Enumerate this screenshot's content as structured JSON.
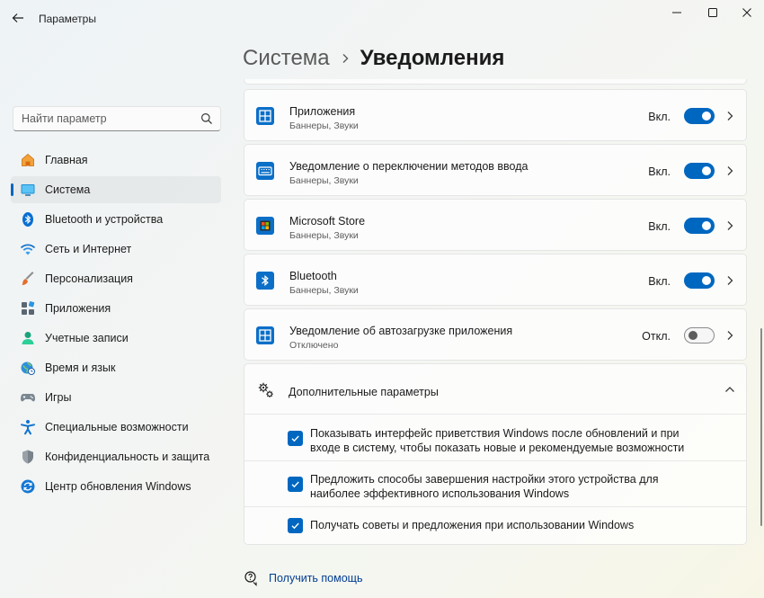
{
  "window": {
    "title": "Параметры",
    "back_icon": "arrow-left-icon",
    "controls": [
      "minimize-icon",
      "maximize-icon",
      "close-icon"
    ]
  },
  "breadcrumb": {
    "parent": "Система",
    "separator_icon": "chevron-right-icon",
    "current": "Уведомления"
  },
  "search": {
    "placeholder": "Найти параметр",
    "value": "",
    "icon": "search-icon"
  },
  "sidebar": {
    "active_index": 1,
    "items": [
      {
        "label": "Главная",
        "icon": "home-icon"
      },
      {
        "label": "Система",
        "icon": "system-display-icon"
      },
      {
        "label": "Bluetooth и устройства",
        "icon": "bluetooth-icon"
      },
      {
        "label": "Сеть и Интернет",
        "icon": "wifi-icon"
      },
      {
        "label": "Персонализация",
        "icon": "brush-icon"
      },
      {
        "label": "Приложения",
        "icon": "apps-icon"
      },
      {
        "label": "Учетные записи",
        "icon": "account-icon"
      },
      {
        "label": "Время и язык",
        "icon": "globe-clock-icon"
      },
      {
        "label": "Игры",
        "icon": "gamepad-icon"
      },
      {
        "label": "Специальные возможности",
        "icon": "accessibility-icon"
      },
      {
        "label": "Конфиденциальность и защита",
        "icon": "shield-icon"
      },
      {
        "label": "Центр обновления Windows",
        "icon": "update-icon"
      }
    ]
  },
  "notifications": {
    "apps": [
      {
        "title": "Приложения",
        "subtitle": "Баннеры, Звуки",
        "state": "Вкл.",
        "on": true,
        "icon": "apps-window-icon"
      },
      {
        "title": "Уведомление о переключении методов ввода",
        "subtitle": "Баннеры, Звуки",
        "state": "Вкл.",
        "on": true,
        "icon": "keyboard-icon"
      },
      {
        "title": "Microsoft Store",
        "subtitle": "Баннеры, Звуки",
        "state": "Вкл.",
        "on": true,
        "icon": "store-icon"
      },
      {
        "title": "Bluetooth",
        "subtitle": "Баннеры, Звуки",
        "state": "Вкл.",
        "on": true,
        "icon": "bluetooth-icon"
      },
      {
        "title": "Уведомление об автозагрузке приложения",
        "subtitle": "Отключено",
        "state": "Откл.",
        "on": false,
        "icon": "apps-window-icon"
      }
    ],
    "advanced": {
      "title": "Дополнительные параметры",
      "icon": "gears-icon",
      "expanded": true,
      "options": [
        {
          "label": "Показывать интерфейс приветствия Windows после обновлений и при входе в систему, чтобы показать новые и рекомендуемые возможности",
          "checked": true
        },
        {
          "label": "Предложить способы завершения настройки этого устройства для наиболее эффективного использования Windows",
          "checked": true
        },
        {
          "label": "Получать советы и предложения при использовании Windows",
          "checked": true
        }
      ]
    }
  },
  "help": {
    "label": "Получить помощь",
    "icon": "help-chat-icon"
  },
  "colors": {
    "accent": "#0067c0",
    "toggle_off_knob": "#5d5d5d",
    "link": "#003e92"
  }
}
